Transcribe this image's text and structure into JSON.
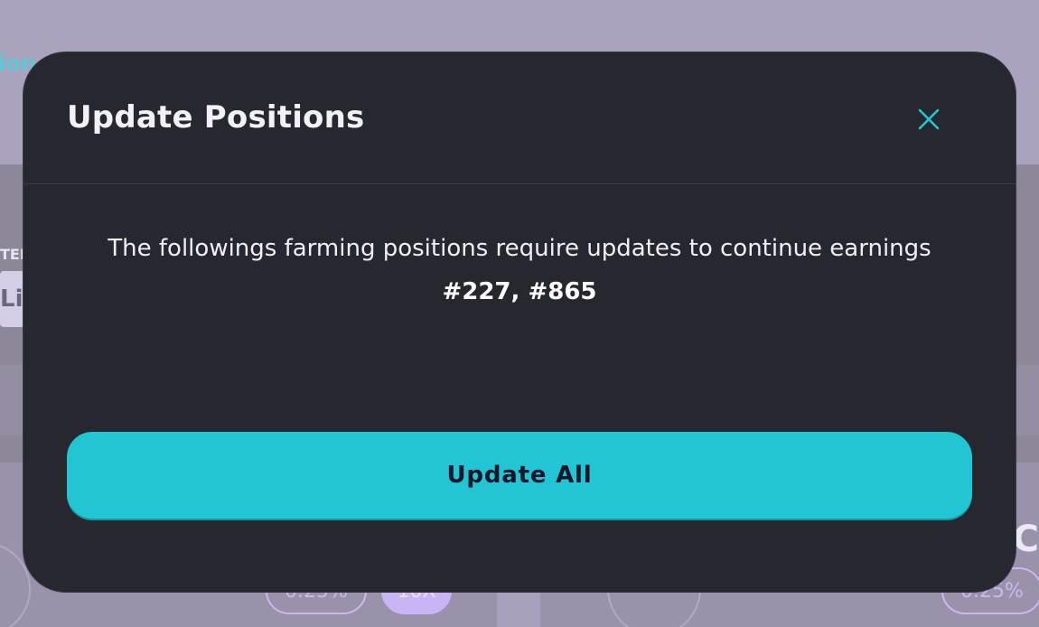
{
  "background": {
    "nav_fragment": "ion",
    "filter_label_fragment": "TER",
    "input_fragment": "Li",
    "fee_pill_left": "0.25%",
    "multiplier_pill": "10X",
    "fee_pill_right": "0.25%",
    "card_title_fragment": "C"
  },
  "modal": {
    "title": "Update Positions",
    "close_icon": "close-icon",
    "message": "The followings farming positions require updates to continue earnings",
    "position_ids": "#227, #865",
    "update_all_label": "Update All"
  },
  "colors": {
    "accent": "#22c5d3",
    "modal_bg": "#27272f",
    "overlay": "#a79fbb"
  }
}
